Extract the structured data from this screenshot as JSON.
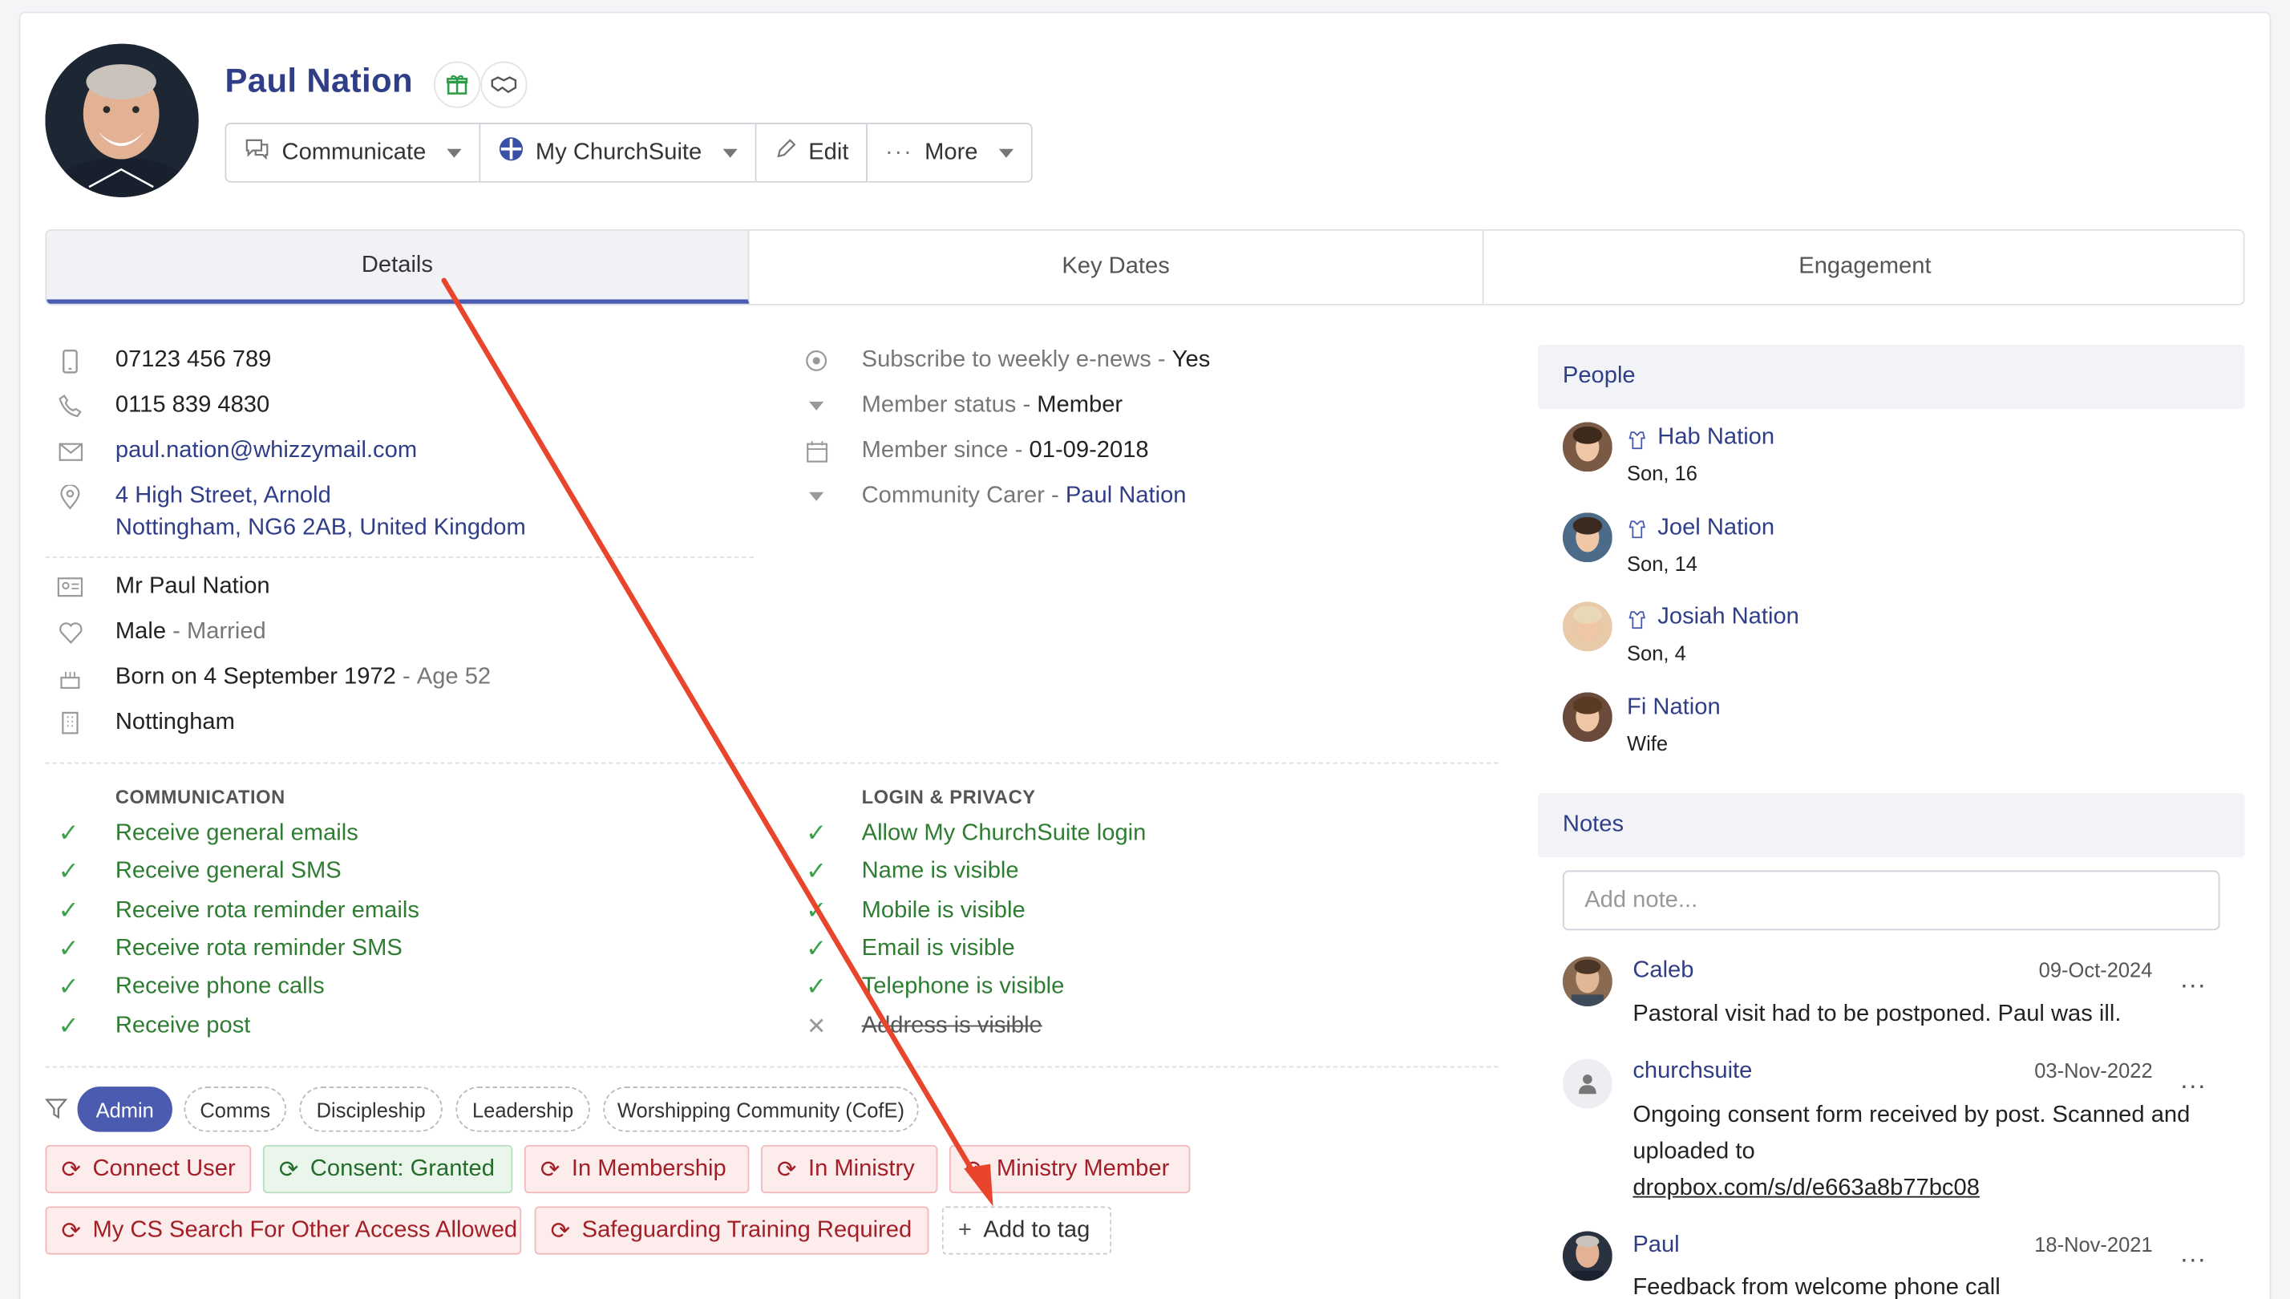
{
  "profile": {
    "name": "Paul Nation",
    "badge_icons": [
      "gift-icon",
      "handshake-icon"
    ]
  },
  "toolbar": {
    "communicate": "Communicate",
    "my_churchsuite": "My ChurchSuite",
    "edit": "Edit",
    "more": "More"
  },
  "tabs": [
    {
      "label": "Details",
      "active": true
    },
    {
      "label": "Key Dates",
      "active": false
    },
    {
      "label": "Engagement",
      "active": false
    }
  ],
  "contact": {
    "mobile": "07123 456 789",
    "telephone": "0115 839 4830",
    "email": "paul.nation@whizzymail.com",
    "address_line1": "4 High Street, Arnold",
    "address_line2": "Nottingham, NG6 2AB, United Kingdom"
  },
  "personal": {
    "full_name": "Mr Paul Nation",
    "sex": "Male",
    "marital": "Married",
    "born": "Born on 4 September 1972",
    "age": "Age 52",
    "location": "Nottingham"
  },
  "fields": {
    "enews_label": "Subscribe to weekly e-news",
    "enews_value": "Yes",
    "status_label": "Member status",
    "status_value": "Member",
    "since_label": "Member since",
    "since_value": "01-09-2018",
    "carer_label": "Community Carer",
    "carer_value": "Paul Nation",
    "sep": " - "
  },
  "communication": {
    "heading": "COMMUNICATION",
    "items": [
      "Receive general emails",
      "Receive general SMS",
      "Receive rota reminder emails",
      "Receive rota reminder SMS",
      "Receive phone calls",
      "Receive post"
    ]
  },
  "privacy": {
    "heading": "LOGIN & PRIVACY",
    "items": [
      {
        "label": "Allow My ChurchSuite login",
        "allowed": true
      },
      {
        "label": "Name is visible",
        "allowed": true
      },
      {
        "label": "Mobile is visible",
        "allowed": true
      },
      {
        "label": "Email is visible",
        "allowed": true
      },
      {
        "label": "Telephone is visible",
        "allowed": true
      },
      {
        "label": "Address is visible",
        "allowed": false
      }
    ]
  },
  "filters": [
    "Admin",
    "Comms",
    "Discipleship",
    "Leadership",
    "Worshipping Community (CofE)"
  ],
  "tags": {
    "connect_user": "Connect User",
    "consent": "Consent: Granted",
    "in_membership": "In Membership",
    "in_ministry": "In Ministry",
    "ministry_member": "Ministry Member",
    "my_cs_search": "My CS Search For Other Access Allowed",
    "safeguarding": "Safeguarding Training Required",
    "add": "Add to tag"
  },
  "people": {
    "heading": "People",
    "items": [
      {
        "name": "Hab Nation",
        "relation": "Son, 16"
      },
      {
        "name": "Joel Nation",
        "relation": "Son, 14"
      },
      {
        "name": "Josiah Nation",
        "relation": "Son, 4"
      },
      {
        "name": "Fi Nation",
        "relation": "Wife"
      }
    ]
  },
  "notes": {
    "heading": "Notes",
    "placeholder": "Add note...",
    "items": [
      {
        "author": "Caleb",
        "date": "09-Oct-2024",
        "text": "Pastoral visit had to be postponed. Paul was ill."
      },
      {
        "author": "churchsuite",
        "date": "03-Nov-2022",
        "text": "Ongoing consent form received by post. Scanned and uploaded to",
        "link": "dropbox.com/s/d/e663a8b77bc08"
      },
      {
        "author": "Paul",
        "date": "18-Nov-2021",
        "text": "Feedback from welcome phone call"
      }
    ],
    "more_label": "..."
  },
  "colors": {
    "brand": "#2f3e87",
    "accent": "#4a5bb0",
    "annotation_arrow": "#e8452c"
  }
}
